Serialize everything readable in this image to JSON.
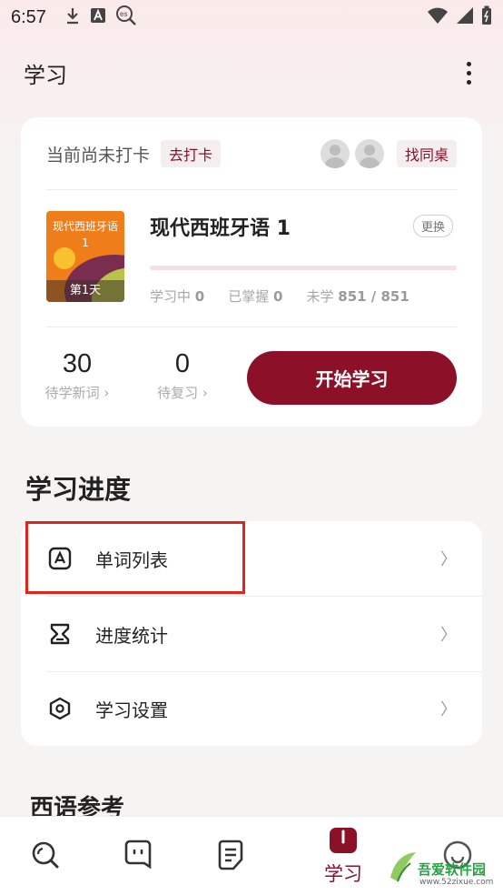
{
  "status_bar": {
    "time": "6:57",
    "icons": [
      "download-icon",
      "font-a-icon",
      "es-search-icon"
    ],
    "right_icons": [
      "wifi-icon",
      "signal-icon",
      "battery-icon"
    ]
  },
  "app_bar": {
    "title": "学习",
    "more_icon": "more-vertical-icon"
  },
  "study_card": {
    "checkin_status": "当前尚未打卡",
    "checkin_button": "去打卡",
    "find_partner_button": "找同桌",
    "book": {
      "cover_title": "现代西班牙语 1",
      "cover_day": "第1天",
      "title": "现代西班牙语 1",
      "change_button": "更换",
      "progress": 0
    },
    "stats": {
      "learning_label": "学习中",
      "learning_value": "0",
      "mastered_label": "已掌握",
      "mastered_value": "0",
      "unlearned_label": "未学",
      "unlearned_value": "851 / 851"
    },
    "new_words": {
      "count": "30",
      "label": "待学新词 ›"
    },
    "review": {
      "count": "0",
      "label": "待复习 ›"
    },
    "start_button": "开始学习"
  },
  "progress_section": {
    "title": "学习进度",
    "items": [
      {
        "label": "单词列表",
        "icon": "word-list-icon"
      },
      {
        "label": "进度统计",
        "icon": "hourglass-icon"
      },
      {
        "label": "学习设置",
        "icon": "settings-hex-icon"
      }
    ]
  },
  "reference_section": {
    "title": "西语参考"
  },
  "bottom_nav": {
    "items": [
      {
        "icon": "search-icon"
      },
      {
        "icon": "chat-face-icon"
      },
      {
        "icon": "document-icon"
      },
      {
        "icon": "study-book-icon",
        "label": "学习",
        "active": true
      },
      {
        "icon": "profile-icon"
      }
    ]
  },
  "watermark": {
    "text": "吾爱软件园",
    "url": "www.52zixue.com"
  },
  "colors": {
    "brand": "#8c1027",
    "highlight_box": "#e1251b",
    "background": "#f6f3f3"
  }
}
